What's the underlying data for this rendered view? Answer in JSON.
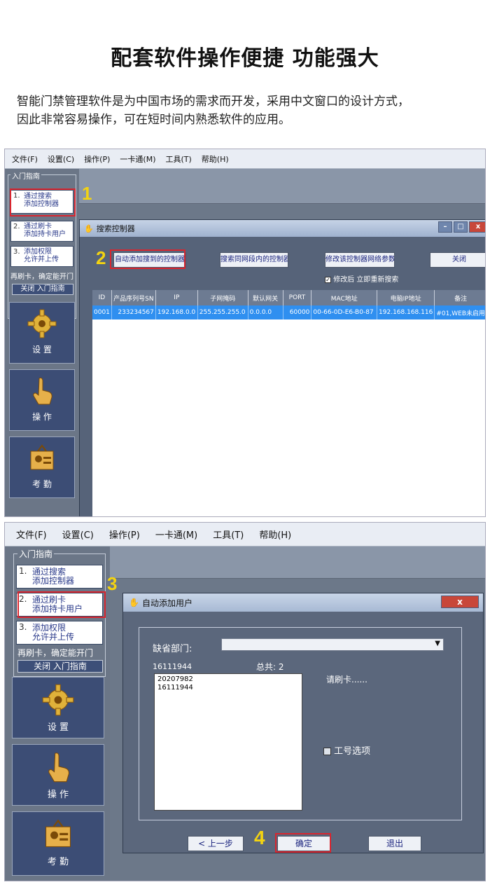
{
  "heading": "配套软件操作便捷 功能强大",
  "intro": {
    "line1": "智能门禁管理软件是为中国市场的需求而开发，采用中文窗口的设计方式，",
    "line2": "因此非常容易操作，可在短时间内熟悉软件的应用。"
  },
  "menu": {
    "s1": [
      "文件(F)",
      "设置(C)",
      "操作(P)",
      "一卡通(M)",
      "工具(T)",
      "帮助(H)"
    ],
    "s2": [
      "文件(F)",
      "设置(C)",
      "操作(P)",
      "一卡通(M)",
      "工具(T)",
      "帮助(H)"
    ]
  },
  "guide": {
    "title": "入门指南",
    "item1": {
      "num": "1.",
      "l1": "通过搜索",
      "l2": "添加控制器"
    },
    "item2": {
      "num": "2.",
      "l1": "通过刷卡",
      "l2": "添加持卡用户"
    },
    "item3": {
      "num": "3.",
      "l1": "添加权限",
      "l2": "允许并上传"
    },
    "note": "再刷卡，确定能开门",
    "close": "关闭 入门指南"
  },
  "nav": {
    "settings": "设 置",
    "operate": "操 作",
    "attendance": "考 勤"
  },
  "steps": [
    "1",
    "2",
    "3",
    "4"
  ],
  "search_dialog": {
    "title": "搜索控制器",
    "btn_auto_add": "自动添加搜到的控制器",
    "btn_same_segment": "搜索同网段内的控制器",
    "btn_modify": "修改该控制器网络参数",
    "btn_close": "关闭",
    "checkbox_label": "修改后 立即重新搜索",
    "columns": [
      "ID",
      "产品序列号SN",
      "IP",
      "子网掩码",
      "默认网关",
      "PORT",
      "MAC地址",
      "电脑IP地址",
      "备注"
    ],
    "rows": [
      [
        "0001",
        "233234567",
        "192.168.0.0",
        "255.255.255.0",
        "0.0.0.0",
        "60000",
        "00-66-0D-E6-B0-87",
        "192.168.168.116",
        "#01,WEB未启用"
      ]
    ]
  },
  "adduser_dialog": {
    "title": "自动添加用户",
    "dept_label": "缺省部门:",
    "current_card": "16111944",
    "total_label": "总共: 2",
    "cards": [
      "20207982",
      "16111944"
    ],
    "prompt": "请刷卡......",
    "workid_label": "工号选项",
    "btn_prev": "< 上一步",
    "btn_ok": "确定",
    "btn_exit": "退出"
  },
  "colors": {
    "accent_red": "#d8262f",
    "step_yellow": "#f3d311",
    "row_blue": "#2f8ff0"
  }
}
